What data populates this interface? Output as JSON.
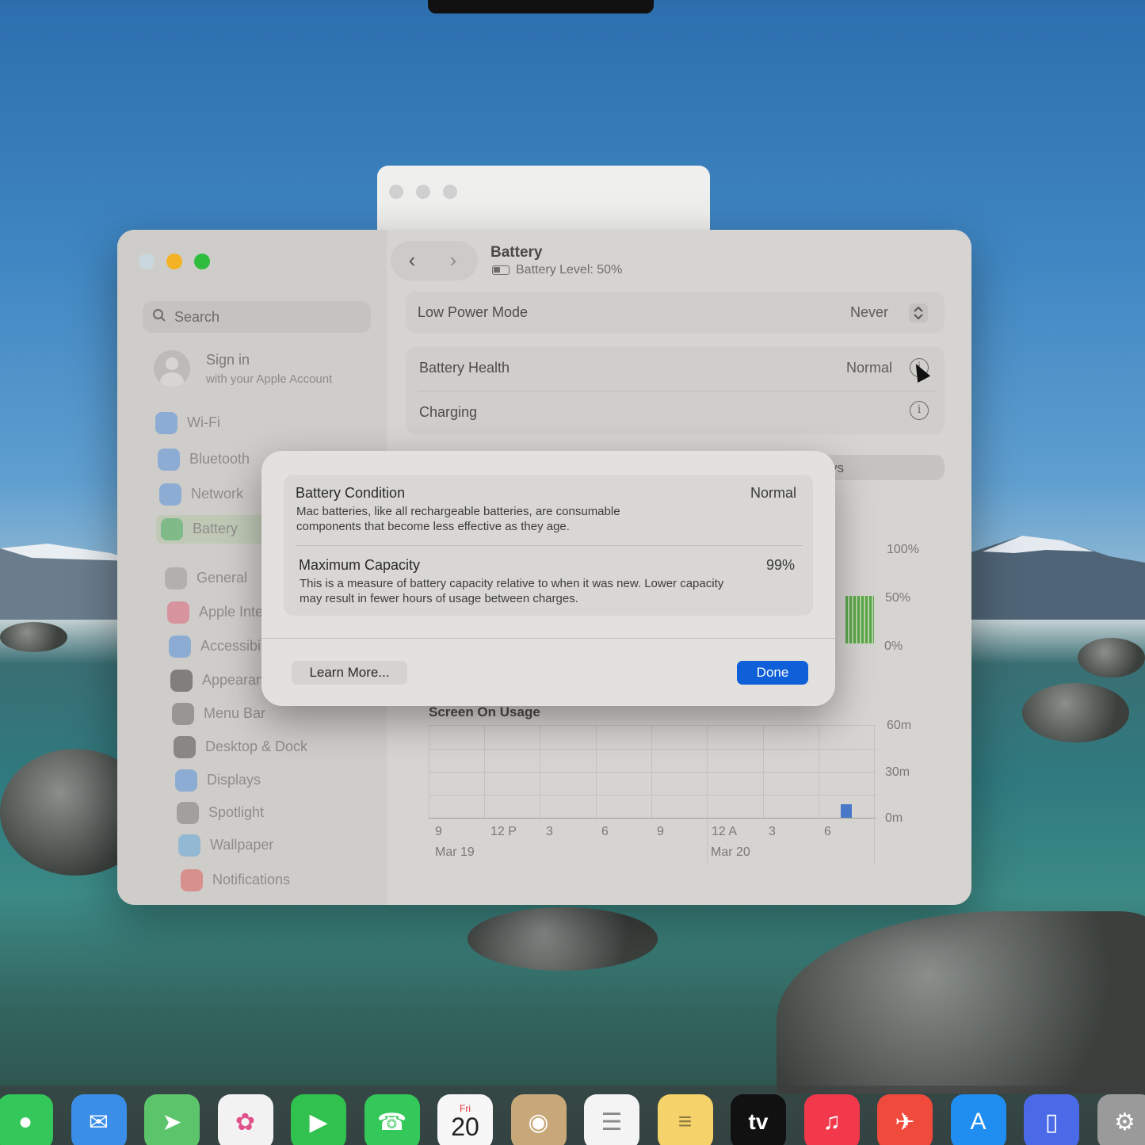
{
  "window": {
    "title": "Battery",
    "subtitle": "Battery Level: 50%",
    "battery_level": 0.5
  },
  "sidebar": {
    "search_placeholder": "Search",
    "account_title": "Sign in",
    "account_subtitle": "with your Apple Account",
    "items": [
      {
        "label": "Wi-Fi",
        "icon": "wifi-icon",
        "color": "#3a86e0"
      },
      {
        "label": "Bluetooth",
        "icon": "bluetooth-icon",
        "color": "#3a86e0"
      },
      {
        "label": "Network",
        "icon": "globe-icon",
        "color": "#3a86e0"
      },
      {
        "label": "Battery",
        "icon": "battery-icon",
        "color": "#34a853"
      },
      {
        "label": "General",
        "icon": "gear-icon",
        "color": "#8e8e8e"
      },
      {
        "label": "Apple Inte",
        "icon": "sparkle-icon",
        "color": "#e0506a"
      },
      {
        "label": "Accessibil",
        "icon": "accessibility-icon",
        "color": "#3a86e0"
      },
      {
        "label": "Appearanc",
        "icon": "appearance-icon",
        "color": "#222222"
      },
      {
        "label": "Menu Bar",
        "icon": "menubar-icon",
        "color": "#555555"
      },
      {
        "label": "Desktop & Dock",
        "icon": "dock-icon",
        "color": "#333333"
      },
      {
        "label": "Displays",
        "icon": "sun-icon",
        "color": "#3a86e0"
      },
      {
        "label": "Spotlight",
        "icon": "magnifier-icon",
        "color": "#6a6a6a"
      },
      {
        "label": "Wallpaper",
        "icon": "flower-icon",
        "color": "#4aa0e0"
      },
      {
        "label": "Notifications",
        "icon": "bell-icon",
        "color": "#e04848"
      }
    ]
  },
  "main": {
    "low_power_label": "Low Power Mode",
    "low_power_value": "Never",
    "health_label": "Battery Health",
    "health_value": "Normal",
    "charging_label": "Charging",
    "partial_tab_text": "ys",
    "battery_chart_ticks": [
      "100%",
      "50%",
      "0%"
    ],
    "usage_title": "Screen On Usage",
    "usage_y_ticks": [
      "60m",
      "30m",
      "0m"
    ],
    "usage_x_ticks": [
      "9",
      "12 P",
      "3",
      "6",
      "9",
      "12 A",
      "3",
      "6"
    ],
    "usage_dates": [
      "Mar 19",
      "Mar 20"
    ]
  },
  "dialog": {
    "condition_label": "Battery Condition",
    "condition_value": "Normal",
    "condition_desc": "Mac batteries, like all rechargeable batteries, are consumable components that become less effective as they age.",
    "capacity_label": "Maximum Capacity",
    "capacity_value": "99%",
    "capacity_desc": "This is a measure of battery capacity relative to when it was new. Lower capacity may result in fewer hours of usage between charges.",
    "learn_more": "Learn More...",
    "done": "Done"
  },
  "dock": {
    "calendar_day": "Fri",
    "calendar_date": "20",
    "tv_label": "tv",
    "apps": [
      {
        "icon": "messages-icon",
        "color": "#34c759"
      },
      {
        "icon": "mail-icon",
        "color": "#3a8ee8"
      },
      {
        "icon": "maps-icon",
        "color": "#5cc46a"
      },
      {
        "icon": "photos-icon",
        "color": "#f2f2f2"
      },
      {
        "icon": "facetime-icon",
        "color": "#30c14f"
      },
      {
        "icon": "phone-icon",
        "color": "#34c759"
      },
      {
        "icon": "calendar-icon",
        "color": "#f7f7f7"
      },
      {
        "icon": "contacts-icon",
        "color": "#c8a878"
      },
      {
        "icon": "reminders-icon",
        "color": "#f4f4f4"
      },
      {
        "icon": "notes-icon",
        "color": "#f6d36a"
      },
      {
        "icon": "tv-icon",
        "color": "#111111"
      },
      {
        "icon": "music-icon",
        "color": "#f2394c"
      },
      {
        "icon": "rocket-icon",
        "color": "#f04a3c"
      },
      {
        "icon": "appstore-icon",
        "color": "#1f8ef0"
      },
      {
        "icon": "iphone-mirroring-icon",
        "color": "#4a6ae8"
      },
      {
        "icon": "settings-icon",
        "color": "#9a9a9a"
      }
    ]
  }
}
